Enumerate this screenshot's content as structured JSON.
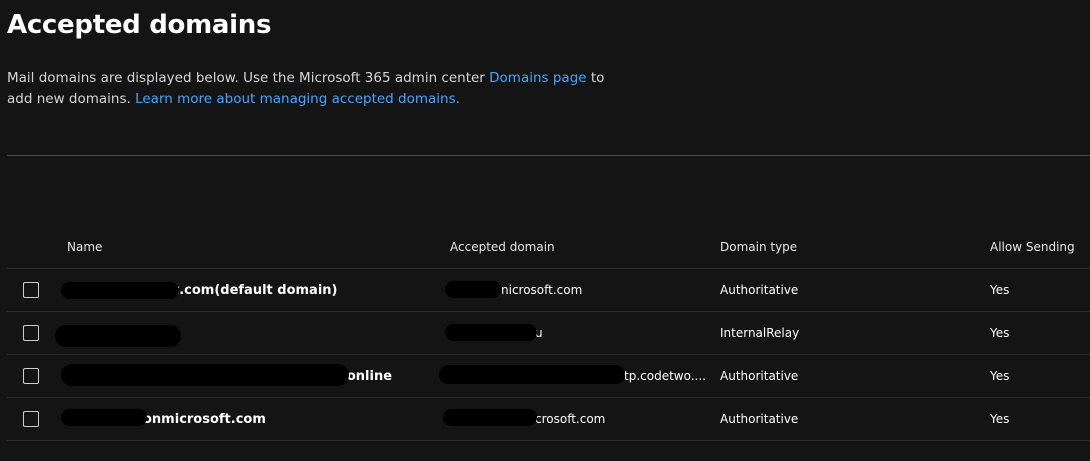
{
  "page": {
    "title": "Accepted domains",
    "description_prefix": "Mail domains are displayed below. Use the Microsoft 365 admin center ",
    "domains_link": "Domains page",
    "description_middle": " to add new domains. ",
    "learn_more_link": "Learn more about managing accepted domains."
  },
  "table": {
    "columns": {
      "name": "Name",
      "accepted_domain": "Accepted domain",
      "domain_type": "Domain type",
      "allow_sending": "Allow Sending"
    },
    "rows": [
      {
        "name": "t.com(default domain)",
        "accepted_domain": "nicrosoft.com",
        "domain_type": "Authoritative",
        "allow_sending": "Yes"
      },
      {
        "name": "",
        "accepted_domain": "u",
        "domain_type": "InternalRelay",
        "allow_sending": "Yes"
      },
      {
        "name": "o.online",
        "accepted_domain": "tp.codetwo....",
        "domain_type": "Authoritative",
        "allow_sending": "Yes"
      },
      {
        "name": "onmicrosoft.com",
        "accepted_domain": "crosoft.com",
        "domain_type": "Authoritative",
        "allow_sending": "Yes"
      }
    ]
  }
}
